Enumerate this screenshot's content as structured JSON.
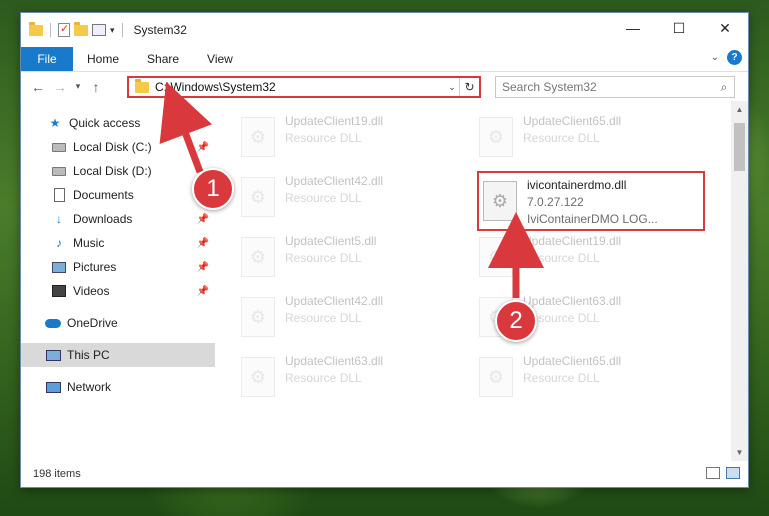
{
  "window": {
    "title": "System32",
    "controls": {
      "minimize": "—",
      "maximize": "☐",
      "close": "✕"
    }
  },
  "ribbon": {
    "tabs": [
      "File",
      "Home",
      "Share",
      "View"
    ],
    "help": "?"
  },
  "address": {
    "path": "C:\\Windows\\System32",
    "search_placeholder": "Search System32"
  },
  "sidebar": {
    "items": [
      {
        "label": "Quick access",
        "icon": "star-icon",
        "pinned": false
      },
      {
        "label": "Local Disk (C:)",
        "icon": "drive-icon",
        "pinned": true
      },
      {
        "label": "Local Disk (D:)",
        "icon": "drive-icon",
        "pinned": false
      },
      {
        "label": "Documents",
        "icon": "documents-icon",
        "pinned": true
      },
      {
        "label": "Downloads",
        "icon": "download-icon",
        "pinned": true
      },
      {
        "label": "Music",
        "icon": "music-icon",
        "pinned": true
      },
      {
        "label": "Pictures",
        "icon": "pictures-icon",
        "pinned": true
      },
      {
        "label": "Videos",
        "icon": "videos-icon",
        "pinned": true
      },
      {
        "label": "OneDrive",
        "icon": "onedrive-icon",
        "pinned": false
      },
      {
        "label": "This PC",
        "icon": "pc-icon",
        "pinned": false,
        "selected": true
      },
      {
        "label": "Network",
        "icon": "network-icon",
        "pinned": false
      }
    ]
  },
  "files": [
    {
      "name": "UpdateClient19.dll",
      "type": "Resource DLL",
      "faded": true
    },
    {
      "name": "UpdateClient65.dll",
      "type": "Resource DLL",
      "faded": true
    },
    {
      "name": "UpdateClient42.dll",
      "type": "Resource DLL",
      "faded": true
    },
    {
      "name": "ivicontainerdmo.dll",
      "type": "7.0.27.122",
      "extra": "IviContainerDMO LOG...",
      "faded": false,
      "highlight": true
    },
    {
      "name": "UpdateClient5.dll",
      "type": "Resource DLL",
      "faded": true
    },
    {
      "name": "UpdateClient19.dll",
      "type": "Resource DLL",
      "faded": true
    },
    {
      "name": "UpdateClient42.dll",
      "type": "Resource DLL",
      "faded": true
    },
    {
      "name": "UpdateClient63.dll",
      "type": "Resource DLL",
      "faded": true
    },
    {
      "name": "UpdateClient63.dll",
      "type": "Resource DLL",
      "faded": true
    },
    {
      "name": "UpdateClient65.dll",
      "type": "Resource DLL",
      "faded": true
    }
  ],
  "status": {
    "item_count": "198 items"
  },
  "annotations": {
    "step1": "1",
    "step2": "2",
    "color": "#d9383c"
  }
}
